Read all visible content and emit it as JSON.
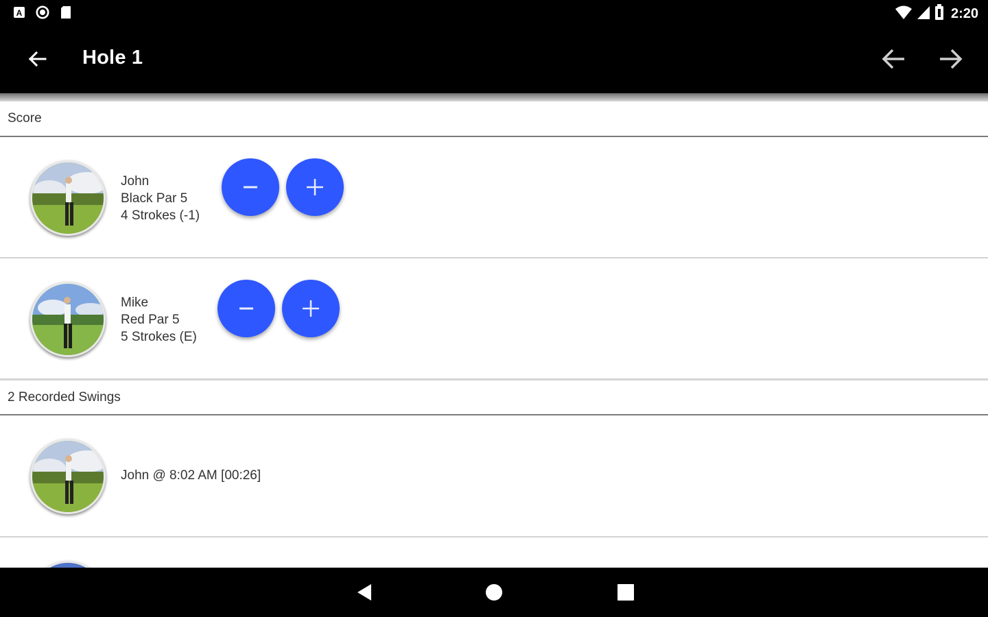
{
  "status_bar": {
    "time": "2:20",
    "left_icons": [
      "a-notification-icon",
      "circle-notification-icon",
      "sd-card-icon"
    ],
    "right_icons": [
      "wifi-icon",
      "signal-icon",
      "battery-icon"
    ]
  },
  "app_bar": {
    "title": "Hole 1",
    "back_icon": "arrow-back-icon",
    "prev_icon": "arrow-left-icon",
    "next_icon": "arrow-right-icon"
  },
  "score_section": {
    "header": "Score",
    "players": [
      {
        "name": "John",
        "tee": "Black Par 5",
        "strokes": "4 Strokes (-1)",
        "decrement_icon": "minus-icon",
        "increment_icon": "plus-icon"
      },
      {
        "name": "Mike",
        "tee": "Red Par 5",
        "strokes": "5 Strokes (E)",
        "decrement_icon": "minus-icon",
        "increment_icon": "plus-icon"
      }
    ]
  },
  "swings_section": {
    "header": "2 Recorded Swings",
    "swings": [
      {
        "label": "John @ 8:02 AM [00:26]"
      }
    ]
  },
  "colors": {
    "fab_blue": "#2e57ff",
    "bar_black": "#000000"
  },
  "bottom_nav": {
    "icons": [
      "nav-back-icon",
      "nav-home-icon",
      "nav-recents-icon"
    ]
  }
}
